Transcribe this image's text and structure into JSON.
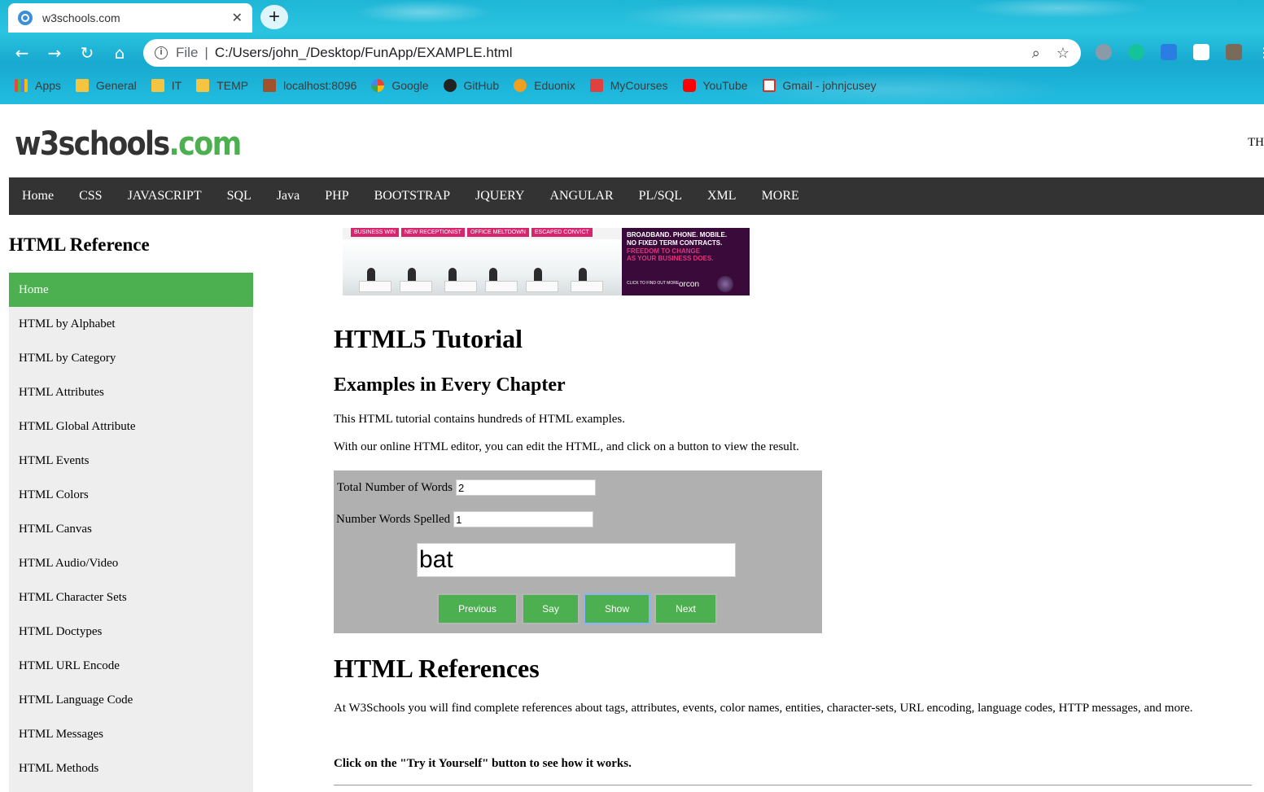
{
  "browser": {
    "tab_title": "w3schools.com",
    "tab_close": "✕",
    "new_tab": "+",
    "url_scheme": "File",
    "url_separator": "|",
    "url_path": "C:/Users/john_/Desktop/FunApp/EXAMPLE.html",
    "bookmarks": [
      "Apps",
      "General",
      "IT",
      "TEMP",
      "localhost:8096",
      "Google",
      "GitHub",
      "Eduonix",
      "MyCourses",
      "YouTube",
      "Gmail - johnjcusey"
    ]
  },
  "site": {
    "logo_w3": "w3schools",
    "logo_com": ".com",
    "top_right_text": "TH",
    "nav": [
      "Home",
      "CSS",
      "JAVASCRIPT",
      "SQL",
      "Java",
      "PHP",
      "BOOTSTRAP",
      "JQUERY",
      "ANGULAR",
      "PL/SQL",
      "XML",
      "MORE"
    ]
  },
  "sidebar": {
    "heading": "HTML Reference",
    "items": [
      "Home",
      "HTML by Alphabet",
      "HTML by Category",
      "HTML Attributes",
      "HTML Global Attribute",
      "HTML Events",
      "HTML Colors",
      "HTML Canvas",
      "HTML Audio/Video",
      "HTML Character Sets",
      "HTML Doctypes",
      "HTML URL Encode",
      "HTML Language Code",
      "HTML Messages",
      "HTML Methods"
    ],
    "active_index": 0
  },
  "ad": {
    "tabs": [
      "BUSINESS WIN",
      "NEW RECEPTIONIST",
      "OFFICE MELTDOWN",
      "ESCAPED CONVICT"
    ],
    "line1": "BROADBAND. PHONE. MOBILE.",
    "line2": "NO FIXED TERM CONTRACTS.",
    "line3": "FREEDOM TO CHANGE",
    "line4": "AS YOUR BUSINESS DOES.",
    "cta": "CLICK TO FIND OUT MORE",
    "brand": "orcon"
  },
  "main": {
    "title": "HTML5 Tutorial",
    "subtitle": "Examples in Every Chapter",
    "para1": "This HTML tutorial contains hundreds of HTML examples.",
    "para2": "With our online HTML editor, you can edit the HTML, and click on a button to view the result.",
    "app": {
      "total_label": "Total Number of Words",
      "total_value": "2",
      "spelled_label": "Number Words Spelled",
      "spelled_value": "1",
      "word_value": "bat",
      "btn_previous": "Previous",
      "btn_say": "Say",
      "btn_show": "Show",
      "btn_next": "Next"
    },
    "refs_title": "HTML References",
    "para3": "At W3Schools you will find complete references about tags, attributes, events, color names, entities, character-sets, URL encoding, language codes, HTTP messages, and more.",
    "para4": "Click on the \"Try it Yourself\" button to see how it works."
  },
  "colors": {
    "accent_green": "#4caf50",
    "nav_bg": "#333333",
    "sidebar_bg": "#eeeeee",
    "app_bg": "#b0b0b0"
  }
}
